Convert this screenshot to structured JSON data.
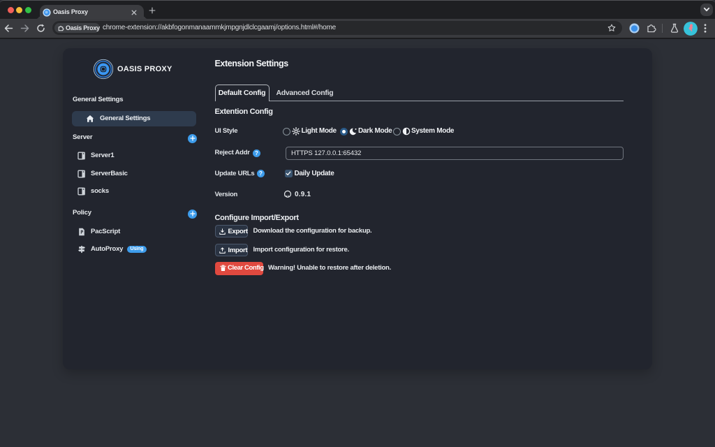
{
  "browser": {
    "tab_title": "Oasis Proxy",
    "chip_label": "Oasis Proxy",
    "url": "chrome-extension://akbfogonmanaammkjmpgnjdlclcgaamj/options.html#/home"
  },
  "sidebar": {
    "logo_text": "OASIS PROXY",
    "sections": [
      {
        "label": "General Settings",
        "items": [
          {
            "label": "General Settings",
            "icon": "home-icon",
            "selected": true
          }
        ]
      },
      {
        "label": "Server",
        "add_button": true,
        "items": [
          {
            "label": "Server1",
            "icon": "server-icon"
          },
          {
            "label": "ServerBasic",
            "icon": "server-icon"
          },
          {
            "label": "socks",
            "icon": "server-icon"
          }
        ]
      },
      {
        "label": "Policy",
        "add_button": true,
        "items": [
          {
            "label": "PacScript",
            "icon": "script-icon"
          },
          {
            "label": "AutoProxy",
            "icon": "signpost-icon",
            "badge": "Using"
          }
        ]
      }
    ]
  },
  "main": {
    "title": "Extension Settings",
    "tabs": [
      {
        "label": "Default Config",
        "active": true
      },
      {
        "label": "Advanced Config",
        "active": false
      }
    ],
    "section_extension": "Extention Config",
    "ui_style": {
      "label": "UI Style",
      "options": [
        {
          "label": "Light Mode",
          "icon": "sun-icon",
          "selected": false
        },
        {
          "label": "Dark Mode",
          "icon": "moon-icon",
          "selected": true
        },
        {
          "label": "System Mode",
          "icon": "half-circle-icon",
          "selected": false
        }
      ]
    },
    "reject_addr": {
      "label": "Reject Addr",
      "value": "HTTPS 127.0.0.1:65432"
    },
    "update_urls": {
      "label": "Update URLs",
      "checkbox_label": "Daily Update",
      "checked": true
    },
    "version": {
      "label": "Version",
      "value": "0.9.1"
    },
    "section_import_export": "Configure Import/Export",
    "actions": [
      {
        "button": "Export",
        "icon": "download-icon",
        "desc": "Download the configuration for backup.",
        "type": "default"
      },
      {
        "button": "Import",
        "icon": "upload-icon",
        "desc": "Import configuration for restore.",
        "type": "default"
      },
      {
        "button": "Clear Config",
        "icon": "trash-icon",
        "desc": "Warning! Unable to restore after deletion.",
        "type": "danger"
      }
    ]
  },
  "colors": {
    "accent": "#3d9ceb",
    "danger": "#e0493f",
    "panel": "#22252e",
    "page": "#2c2f36"
  }
}
